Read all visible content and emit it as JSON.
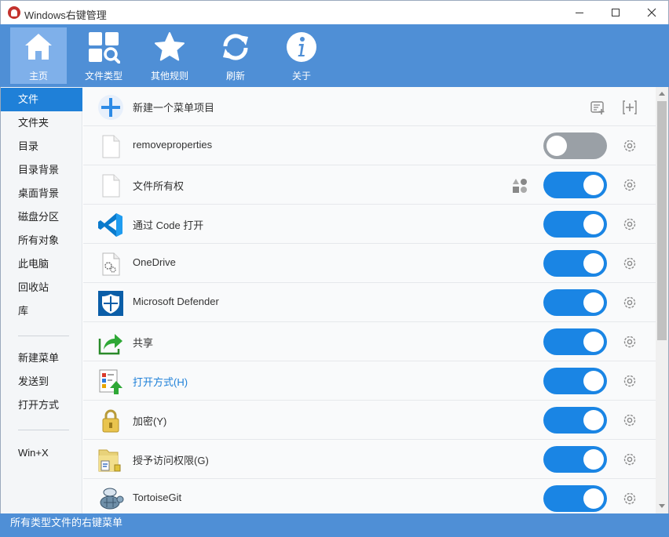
{
  "window": {
    "title": "Windows右键管理"
  },
  "toolbar": {
    "items": [
      {
        "label": "主页",
        "icon": "home-icon"
      },
      {
        "label": "文件类型",
        "icon": "file-types-icon"
      },
      {
        "label": "其他规则",
        "icon": "star-icon"
      },
      {
        "label": "刷新",
        "icon": "refresh-icon"
      },
      {
        "label": "关于",
        "icon": "info-icon"
      }
    ],
    "active_index": 0
  },
  "sidebar": {
    "groups": [
      [
        "文件",
        "文件夹",
        "目录",
        "目录背景",
        "桌面背景",
        "磁盘分区",
        "所有对象",
        "此电脑",
        "回收站",
        "库"
      ],
      [
        "新建菜单",
        "发送到",
        "打开方式"
      ],
      [
        "Win+X"
      ]
    ],
    "selected": "文件"
  },
  "new_item": {
    "label": "新建一个菜单项目",
    "actions": [
      "add-group-icon",
      "add-item-icon"
    ]
  },
  "menu_items": [
    {
      "label": "removeproperties",
      "icon": "blank-file-icon",
      "enabled": false
    },
    {
      "label": "文件所有权",
      "icon": "blank-file-icon",
      "enabled": true,
      "extra_icon": "shapes-icon"
    },
    {
      "label": "通过 Code 打开",
      "icon": "vscode-icon",
      "enabled": true
    },
    {
      "label": "OneDrive",
      "icon": "onedrive-file-icon",
      "enabled": true
    },
    {
      "label": "Microsoft Defender",
      "icon": "defender-shield-icon",
      "enabled": true
    },
    {
      "label": "共享",
      "icon": "share-arrow-icon",
      "enabled": true
    },
    {
      "label": "打开方式(H)",
      "icon": "open-with-icon",
      "enabled": true,
      "highlight": true
    },
    {
      "label": "加密(Y)",
      "icon": "lock-icon",
      "enabled": true
    },
    {
      "label": "授予访问权限(G)",
      "icon": "grant-access-icon",
      "enabled": true
    },
    {
      "label": "TortoiseGit",
      "icon": "tortoisegit-icon",
      "enabled": true
    }
  ],
  "status": {
    "text": "所有类型文件的右键菜单"
  },
  "colors": {
    "accent": "#4f8fd6",
    "toggle_on": "#1a85e4",
    "toggle_off": "#9aa0a6",
    "selected": "#1f80d8"
  }
}
